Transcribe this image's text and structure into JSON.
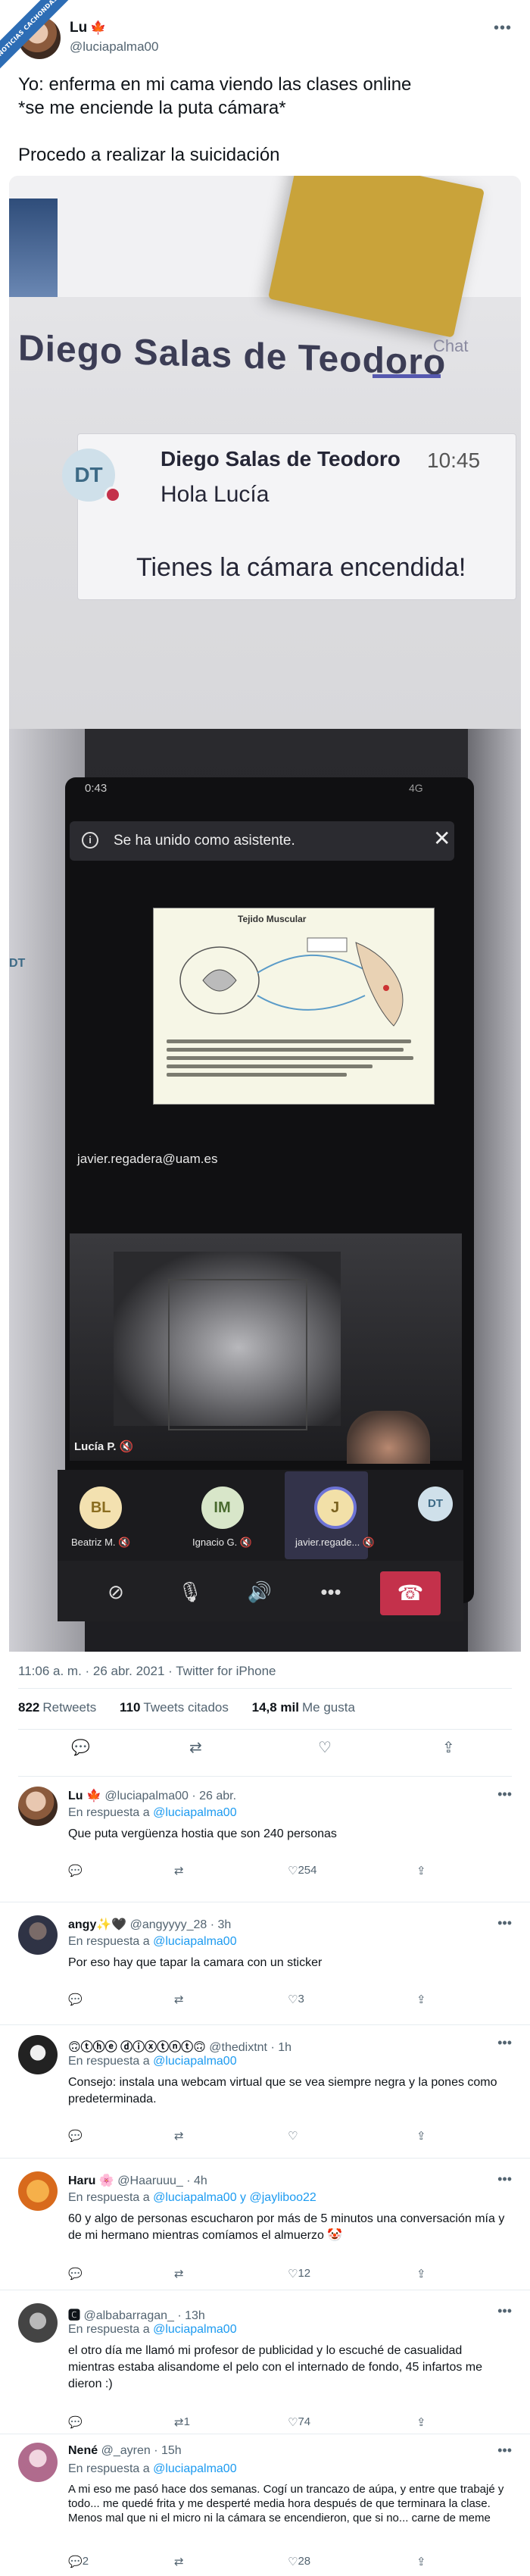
{
  "ribbon": "NOTICIAS CACHONDAS",
  "tweet": {
    "name": "Lu",
    "flag": "🍁",
    "handle": "@luciapalma00",
    "text_lines": [
      "Yo: enferma en mi cama viendo las clases online",
      "*se me enciende la puta cámara*",
      "Procedo a realizar la suicidación"
    ],
    "meta": "11:06 a. m. · 26 abr. 2021 · Twitter for iPhone",
    "retweets_count": "822",
    "retweets_label": "Retweets",
    "quotes_count": "110",
    "quotes_label": "Tweets citados",
    "likes_count": "14,8 mil",
    "likes_label": "Me gusta"
  },
  "photo1": {
    "title": "Diego Salas de Teodoro",
    "chat_tab": "Chat",
    "avatar_initials": "DT",
    "sender": "Diego Salas de Teodoro",
    "time": "10:45",
    "message": "Hola Lucía",
    "highlight": "Tienes la cámara encendida!"
  },
  "photo2": {
    "status_time": "0:43",
    "status_net": "4G",
    "toast": "Se ha unido como asistente.",
    "slide_title": "Tejido Muscular",
    "presenter_email": "javier.regadera@uam.es",
    "self_label": "Lucía P.",
    "side_initials": "DT",
    "participants": [
      {
        "initials": "BL",
        "name": "Beatriz M.",
        "color": "#f3e1b0",
        "text": "#8a6d1f"
      },
      {
        "initials": "IM",
        "name": "Ignacio G.",
        "color": "#d8e6c9",
        "text": "#4a6b2f"
      },
      {
        "initials": "J",
        "name": "javier.regade...",
        "color": "#f2e0a8",
        "text": "#7a6220"
      },
      {
        "initials": "DT",
        "name": "",
        "color": "#cfe0ea",
        "text": "#3d6a86"
      }
    ]
  },
  "replies": [
    {
      "name": "Lu 🍁",
      "handle": "@luciapalma00 · 26 abr.",
      "resp_prefix": "En respuesta a",
      "resp_users": "@luciapalma00",
      "text": "Que puta vergüenza hostia que son 240 personas",
      "rts": "",
      "likes": "254",
      "avatar": "#8b5a3c"
    },
    {
      "name": "angy✨🖤",
      "handle": "@angyyyy_28 · 3h",
      "resp_prefix": "En respuesta a",
      "resp_users": "@luciapalma00",
      "text": "Por eso hay que tapar la camara con un sticker",
      "rts": "",
      "likes": "3",
      "avatar": "#3a3f52"
    },
    {
      "name": "🙃ⓣⓗⓔ ⓓⓘⓧⓣⓝⓣ🙃",
      "handle": "@thedixtnt · 1h",
      "resp_prefix": "En respuesta a",
      "resp_users": "@luciapalma00",
      "text": "Consejo: instala una webcam virtual que se vea siempre negra y la pones como predeterminada.",
      "rts": "",
      "likes": "",
      "avatar": "#2b2b2b"
    },
    {
      "name": "Haru 🌸",
      "handle": "@Haaruuu_ · 4h",
      "resp_prefix": "En respuesta a",
      "resp_users": "@luciapalma00 y @jayliboo22",
      "text": "60 y algo de personas escucharon por más de 5 minutos una conversación mía y de mi hermano mientras comíamos el almuerzo 🤡",
      "rts": "",
      "likes": "12",
      "avatar": "#e8943a"
    },
    {
      "name": "🅲",
      "handle": "@albabarragan_ · 13h",
      "resp_prefix": "En respuesta a",
      "resp_users": "@luciapalma00",
      "text": "el otro día me llamó mi profesor de publicidad y lo escuché de casualidad mientras estaba alisandome el pelo con el internado de fondo, 45 infartos me dieron :)",
      "rts": "1",
      "likes": "74",
      "avatar": "#555"
    },
    {
      "name": "Nené",
      "handle": "@_ayren · 15h",
      "resp_prefix": "En respuesta a",
      "resp_users": "@luciapalma00",
      "text": "A mi eso me pasó hace dos semanas. Cogí un trancazo de aúpa, y entre que trabajé y todo... me quedé frita y me desperté media hora después de que terminara la clase. Menos mal que ni el micro ni la cámara se encendieron, que si no... carne de meme",
      "rts": "",
      "likes": "28",
      "comments": "2",
      "avatar": "#c98aa8"
    }
  ]
}
